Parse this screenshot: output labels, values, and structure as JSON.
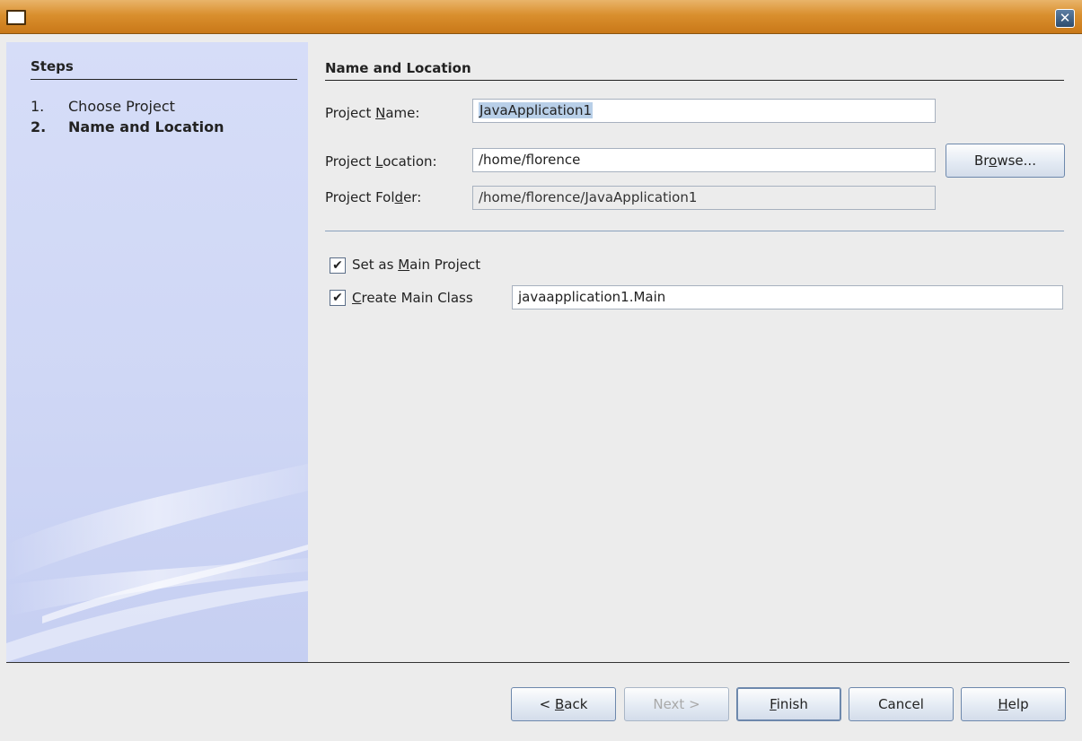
{
  "window": {
    "close_glyph": "✕"
  },
  "steps": {
    "title": "Steps",
    "items": [
      {
        "num": "1.",
        "label": "Choose Project"
      },
      {
        "num": "2.",
        "label": "Name and Location"
      }
    ]
  },
  "section": {
    "title": "Name and Location"
  },
  "form": {
    "project_name": {
      "label_pre": "Project ",
      "label_mnemonic": "N",
      "label_post": "ame:",
      "value": "JavaApplication1"
    },
    "project_location": {
      "label_pre": "Project ",
      "label_mnemonic": "L",
      "label_post": "ocation:",
      "value": "/home/florence"
    },
    "project_folder": {
      "label_pre": "Project Fol",
      "label_mnemonic": "d",
      "label_post": "er:",
      "value": "/home/florence/JavaApplication1"
    },
    "browse": {
      "pre": "Br",
      "mnemonic": "o",
      "post": "wse..."
    },
    "set_main": {
      "pre": "Set as ",
      "mnemonic": "M",
      "post": "ain Project",
      "checked": true,
      "check_glyph": "✔"
    },
    "create_main": {
      "pre": "",
      "mnemonic": "C",
      "post": "reate Main Class",
      "checked": true,
      "check_glyph": "✔",
      "value": "javaapplication1.Main"
    }
  },
  "buttons": {
    "back": {
      "pre": "< ",
      "mnemonic": "B",
      "post": "ack"
    },
    "next": {
      "label": "Next >"
    },
    "finish": {
      "pre": "",
      "mnemonic": "F",
      "post": "inish"
    },
    "cancel": {
      "label": "Cancel"
    },
    "help": {
      "pre": "",
      "mnemonic": "H",
      "post": "elp"
    }
  },
  "colors": {
    "title_bar": "#d98f2e",
    "steps_panel": "#cfd7f5",
    "selection": "#b8cfe8"
  }
}
